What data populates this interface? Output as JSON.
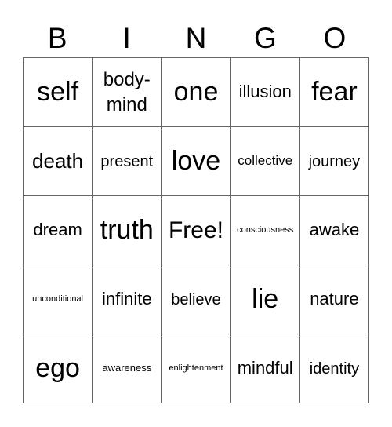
{
  "header": [
    "B",
    "I",
    "N",
    "G",
    "O"
  ],
  "cells": [
    {
      "text": "self",
      "size": "s-xl"
    },
    {
      "text": "body-mind",
      "size": "s-ml"
    },
    {
      "text": "one",
      "size": "s-xl"
    },
    {
      "text": "illusion",
      "size": "s-s"
    },
    {
      "text": "fear",
      "size": "s-xl"
    },
    {
      "text": "death",
      "size": "s-m"
    },
    {
      "text": "present",
      "size": "s-sm"
    },
    {
      "text": "love",
      "size": "s-xl"
    },
    {
      "text": "collective",
      "size": "s-xs"
    },
    {
      "text": "journey",
      "size": "s-sm"
    },
    {
      "text": "dream",
      "size": "s-s"
    },
    {
      "text": "truth",
      "size": "s-xl"
    },
    {
      "text": "Free!",
      "size": "s-l"
    },
    {
      "text": "consciousness",
      "size": "s-tiny"
    },
    {
      "text": "awake",
      "size": "s-s"
    },
    {
      "text": "unconditional",
      "size": "s-tiny"
    },
    {
      "text": "infinite",
      "size": "s-s"
    },
    {
      "text": "believe",
      "size": "s-sm"
    },
    {
      "text": "lie",
      "size": "s-xl"
    },
    {
      "text": "nature",
      "size": "s-s"
    },
    {
      "text": "ego",
      "size": "s-xl"
    },
    {
      "text": "awareness",
      "size": "s-xxs"
    },
    {
      "text": "enlightenment",
      "size": "s-tiny"
    },
    {
      "text": "mindful",
      "size": "s-s"
    },
    {
      "text": "identity",
      "size": "s-sm"
    }
  ]
}
